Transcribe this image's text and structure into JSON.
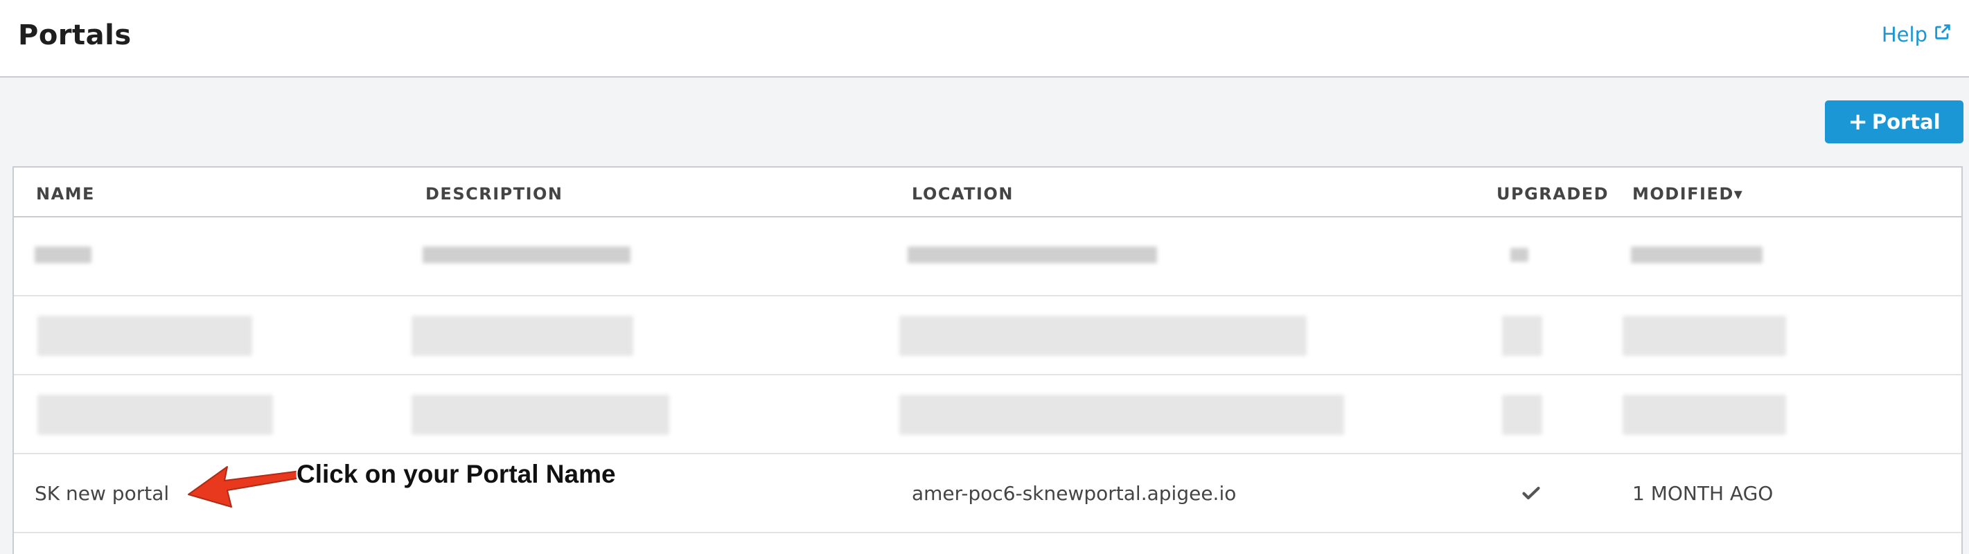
{
  "header": {
    "title": "Portals",
    "help_label": "Help"
  },
  "toolbar": {
    "add_portal_label": "Portal"
  },
  "table": {
    "columns": [
      "NAME",
      "DESCRIPTION",
      "LOCATION",
      "UPGRADED",
      "MODIFIED"
    ],
    "sort_indicator": "▾",
    "rows": [
      {
        "name": "SK new portal",
        "description": "",
        "location": "amer-poc6-sknewportal.apigee.io",
        "upgraded": true,
        "modified": "1 MONTH AGO"
      }
    ]
  },
  "annotation": {
    "text": "Click on your Portal Name",
    "color": "#e8381e"
  },
  "colors": {
    "accent": "#1a97d4",
    "border": "#c9cdd2"
  },
  "icons": {
    "external_link": "external-link-icon",
    "plus": "plus-icon",
    "check": "check-icon",
    "sort": "sort-desc-icon"
  }
}
